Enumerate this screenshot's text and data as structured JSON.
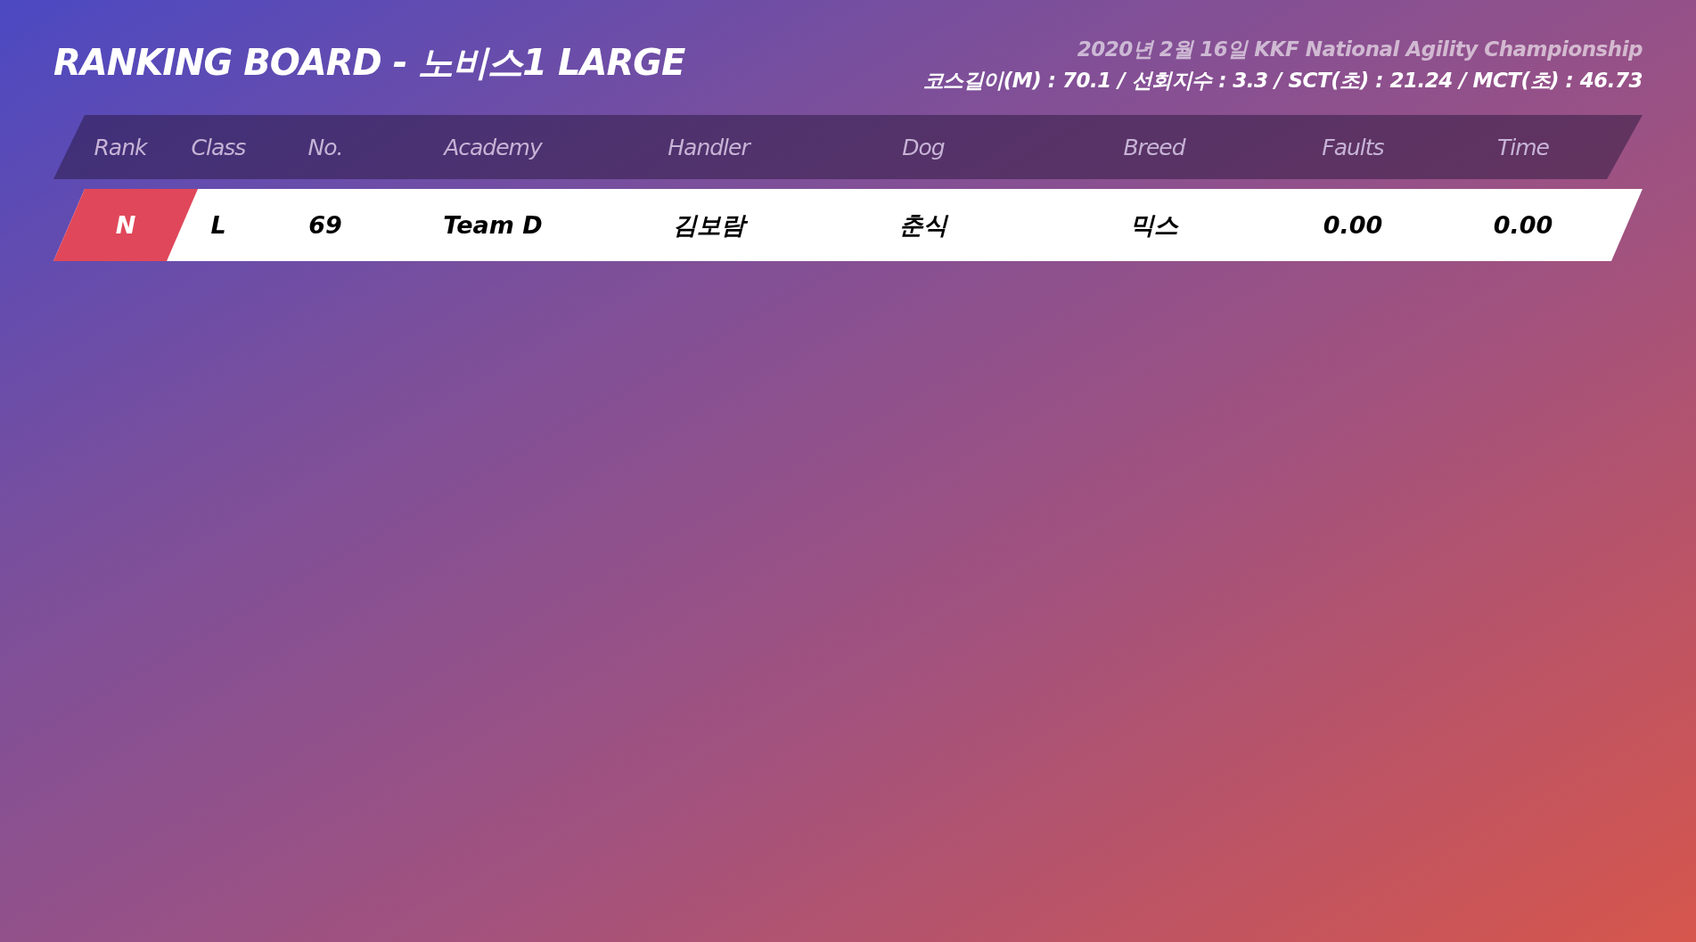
{
  "title": "RANKING BOARD - 노비스1 LARGE",
  "event": "2020년 2월 16일 KKF National Agility Championship",
  "course_info": "코스길이(M) : 70.1 / 선회지수 : 3.3 / SCT(초) : 21.24 / MCT(초) : 46.73",
  "table": {
    "columns": [
      {
        "label": "Rank",
        "kind": "rank"
      },
      {
        "label": "Class",
        "kind": "plain"
      },
      {
        "label": "No.",
        "kind": "plain"
      },
      {
        "label": "Academy",
        "kind": "plain"
      },
      {
        "label": "Handler",
        "kind": "plain"
      },
      {
        "label": "Dog",
        "kind": "plain"
      },
      {
        "label": "Breed",
        "kind": "plain"
      },
      {
        "label": "Faults",
        "kind": "plain"
      },
      {
        "label": "Time",
        "kind": "plain"
      }
    ],
    "rows": [
      {
        "cells": [
          "N",
          "L",
          "69",
          "Team D",
          "김보람",
          "춘식",
          "믹스",
          "0.00",
          "0.00"
        ]
      }
    ]
  }
}
